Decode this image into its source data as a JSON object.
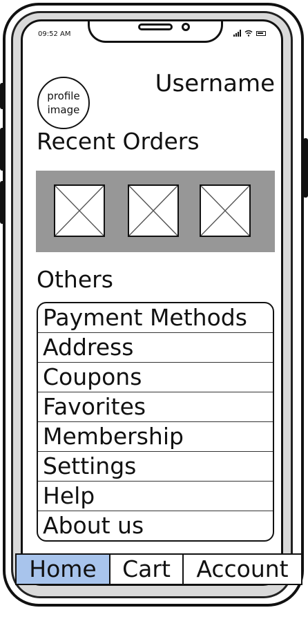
{
  "status_bar": {
    "time": "09:52 AM"
  },
  "profile": {
    "image_label_line1": "profile",
    "image_label_line2": "image",
    "username": "Username"
  },
  "recent_orders": {
    "title": "Recent Orders",
    "items_count": 3
  },
  "others": {
    "title": "Others",
    "items": [
      {
        "label": "Payment Methods"
      },
      {
        "label": "Address"
      },
      {
        "label": "Coupons"
      },
      {
        "label": "Favorites"
      },
      {
        "label": "Membership"
      },
      {
        "label": "Settings"
      },
      {
        "label": "Help"
      },
      {
        "label": "About us"
      }
    ]
  },
  "tabbar": {
    "tabs": [
      {
        "label": "Home",
        "active": true
      },
      {
        "label": "Cart",
        "active": false
      },
      {
        "label": "Account",
        "active": false
      }
    ]
  },
  "colors": {
    "active_tab": "#a8c4ec",
    "orders_panel": "#979797"
  }
}
